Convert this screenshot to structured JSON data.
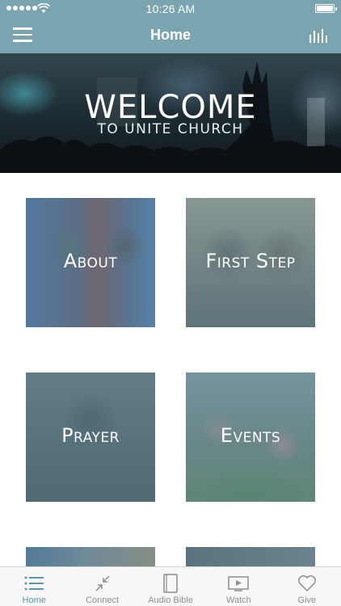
{
  "status_bar": {
    "time": "10:26 AM"
  },
  "header": {
    "title": "Home"
  },
  "hero": {
    "title": "WELCOME",
    "subtitle": "TO UNITE CHURCH"
  },
  "tiles": [
    {
      "label": "About"
    },
    {
      "label": "First Step"
    },
    {
      "label": "Prayer"
    },
    {
      "label": "Events"
    }
  ],
  "tabbar": {
    "tabs": [
      {
        "label": "Home",
        "icon": "list-icon",
        "active": true
      },
      {
        "label": "Connect",
        "icon": "collapse-arrows-icon",
        "active": false
      },
      {
        "label": "Audio Bible",
        "icon": "book-icon",
        "active": false
      },
      {
        "label": "Watch",
        "icon": "video-play-icon",
        "active": false
      },
      {
        "label": "Give",
        "icon": "heart-icon",
        "active": false
      }
    ]
  },
  "colors": {
    "accent": "#7aa5b0",
    "active_tab": "#5d97a6",
    "inactive_tab": "#8e8e93"
  }
}
